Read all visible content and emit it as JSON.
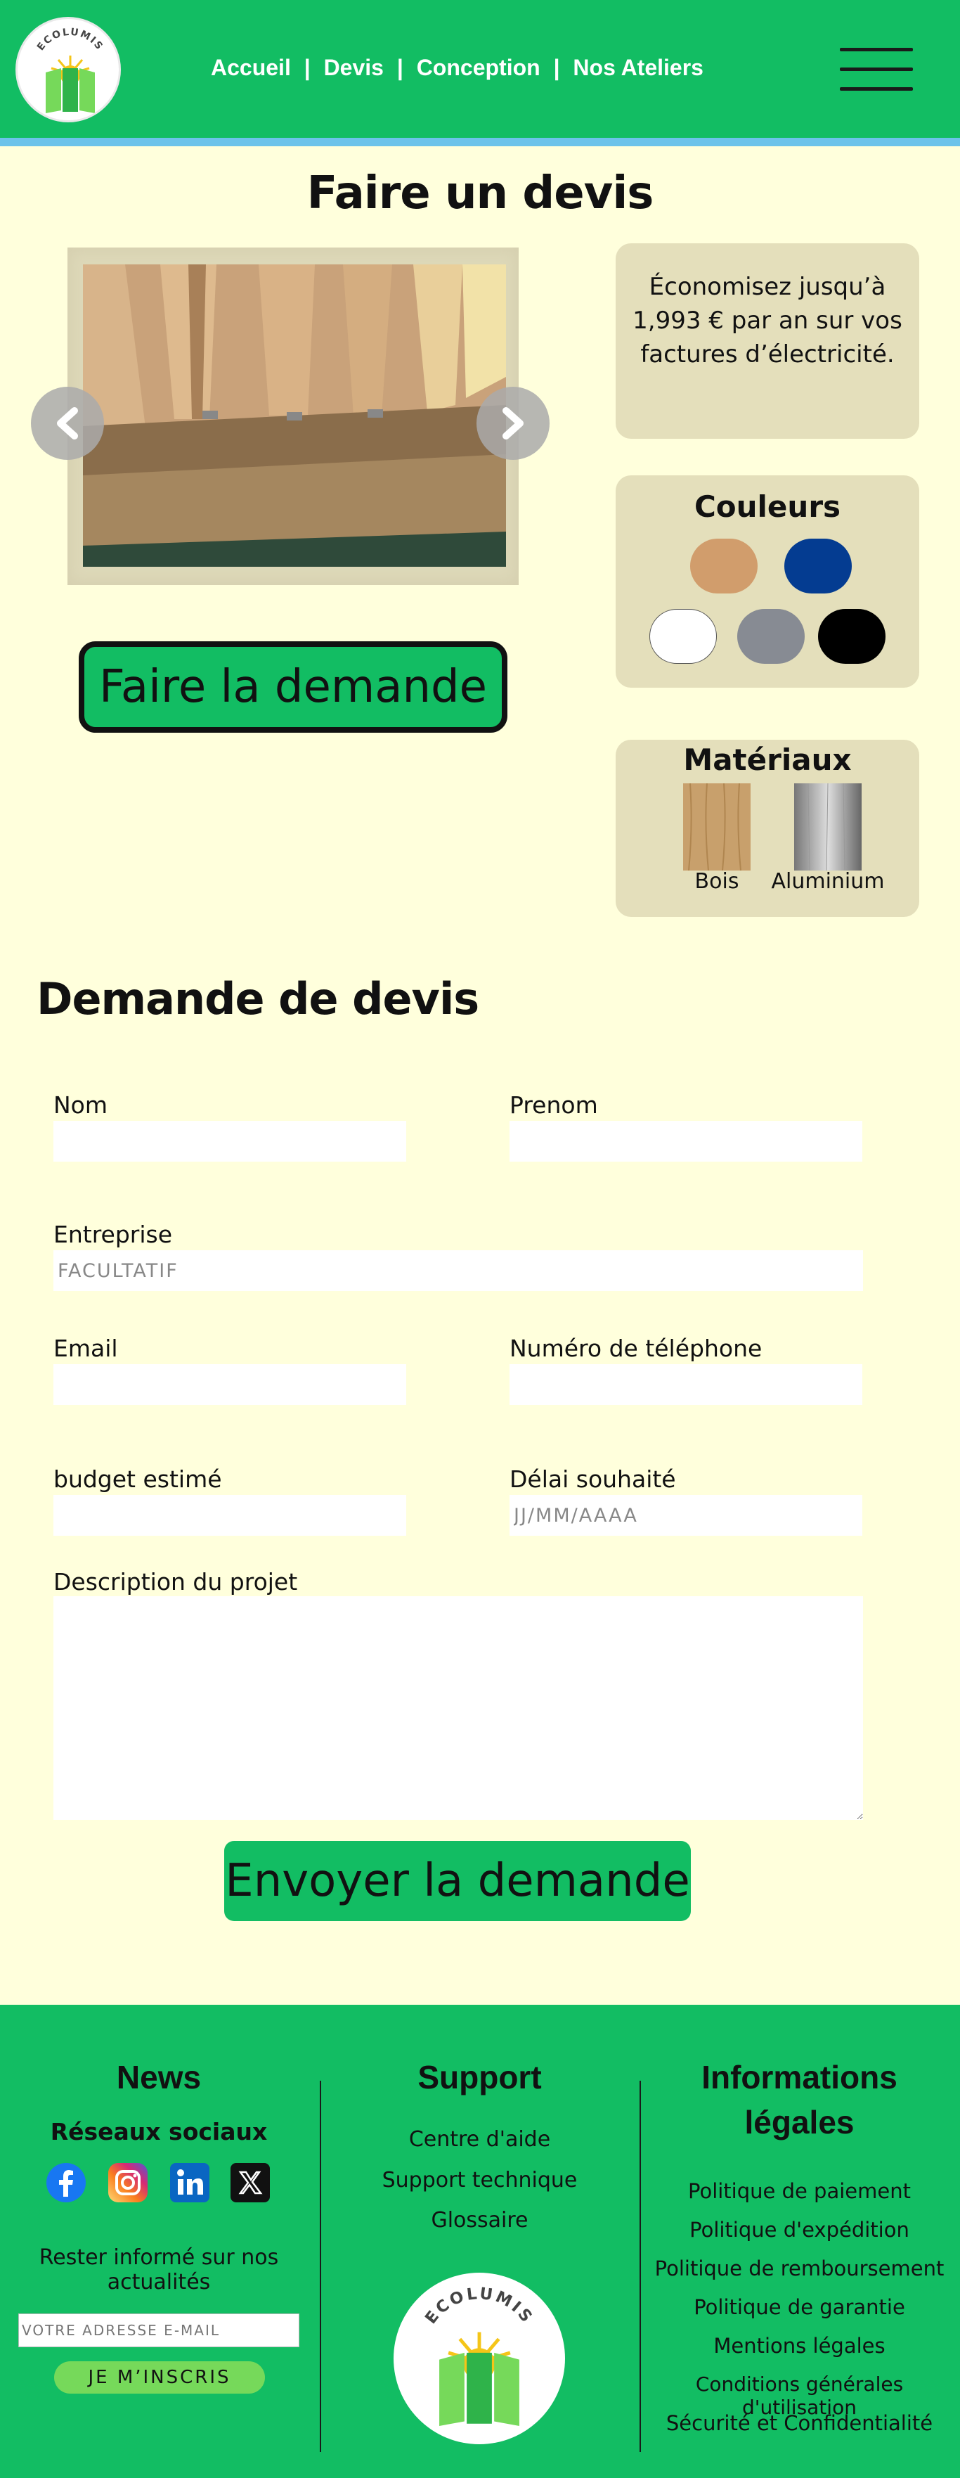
{
  "header": {
    "logo_text": "ECOLUMIS",
    "nav": [
      "Accueil",
      "Devis",
      "Conception",
      "Nos Ateliers"
    ],
    "nav_separator": "|"
  },
  "page": {
    "title": "Faire un devis",
    "cta_label": "Faire la demande",
    "eco_text": "Économisez jusqu’à 1,993 € par an sur vos factures d’électricité.",
    "colors_title": "Couleurs",
    "colors": [
      "#d19d6c",
      "#043c91",
      "#ffffff",
      "#878b93",
      "#000000"
    ],
    "materials_title": "Matériaux",
    "materials": [
      "Bois",
      "Aluminium"
    ]
  },
  "form": {
    "title": "Demande de devis",
    "nom_label": "Nom",
    "prenom_label": "Prenom",
    "entreprise_label": "Entreprise",
    "entreprise_placeholder": "FACULTATIF",
    "email_label": "Email",
    "telephone_label": "Numéro de téléphone",
    "budget_label": "budget estimé",
    "delai_label": "Délai souhaité",
    "delai_placeholder": "JJ/MM/AAAA",
    "description_label": "Description du projet",
    "submit_label": "Envoyer la demande"
  },
  "footer": {
    "news_title": "News",
    "social_title": "Réseaux sociaux",
    "social_icons": [
      "facebook-icon",
      "instagram-icon",
      "linkedin-icon",
      "x-icon"
    ],
    "newsletter_text": "Rester informé sur nos actualités",
    "newsletter_placeholder": "VOTRE ADRESSE E-MAIL",
    "newsletter_button": "JE M’INSCRIS",
    "support_title": "Support",
    "support_links": [
      "Centre d'aide",
      "Support technique",
      "Glossaire"
    ],
    "legal_title_1": "Informations",
    "legal_title_2": "légales",
    "legal_links": [
      "Politique de paiement",
      "Politique d'expédition",
      "Politique de remboursement",
      "Politique de garantie",
      "Mentions légales",
      "Conditions générales d'utilisation",
      "Sécurité et Confidentialité"
    ]
  }
}
